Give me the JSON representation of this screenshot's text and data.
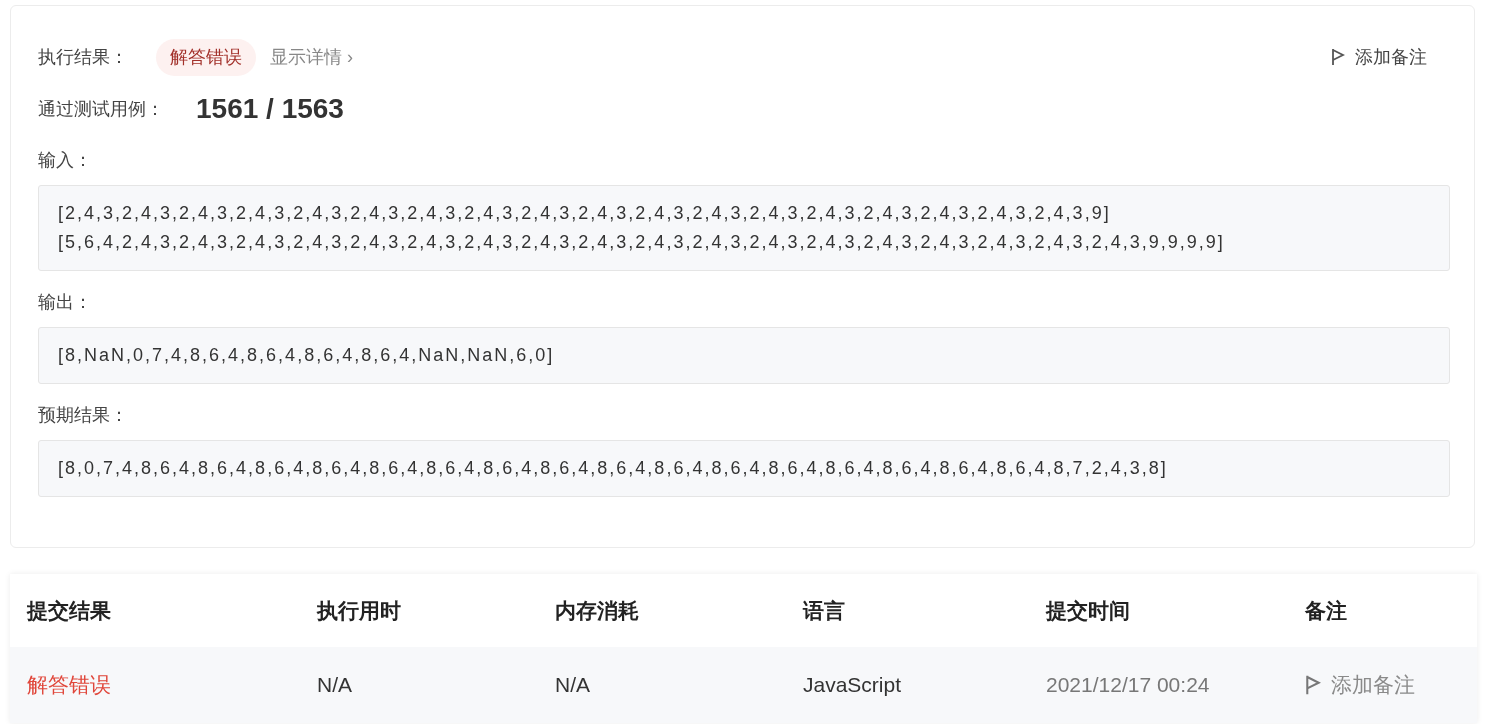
{
  "result": {
    "label": "执行结果：",
    "status": "解答错误",
    "details_link": "显示详情 ›",
    "note_button": "添加备注"
  },
  "passed": {
    "label": "通过测试用例：",
    "value": "1561 / 1563"
  },
  "blocks": [
    {
      "label": "输入：",
      "lines": [
        "[2,4,3,2,4,3,2,4,3,2,4,3,2,4,3,2,4,3,2,4,3,2,4,3,2,4,3,2,4,3,2,4,3,2,4,3,2,4,3,2,4,3,2,4,3,2,4,3,2,4,3,2,4,3,9]",
        "[5,6,4,2,4,3,2,4,3,2,4,3,2,4,3,2,4,3,2,4,3,2,4,3,2,4,3,2,4,3,2,4,3,2,4,3,2,4,3,2,4,3,2,4,3,2,4,3,2,4,3,2,4,3,2,4,3,9,9,9,9]"
      ]
    },
    {
      "label": "输出：",
      "lines": [
        "[8,NaN,0,7,4,8,6,4,8,6,4,8,6,4,8,6,4,NaN,NaN,6,0]"
      ]
    },
    {
      "label": "预期结果：",
      "lines": [
        "[8,0,7,4,8,6,4,8,6,4,8,6,4,8,6,4,8,6,4,8,6,4,8,6,4,8,6,4,8,6,4,8,6,4,8,6,4,8,6,4,8,6,4,8,6,4,8,6,4,8,6,4,8,7,2,4,3,8]"
      ]
    }
  ],
  "table": {
    "columns": [
      "提交结果",
      "执行用时",
      "内存消耗",
      "语言",
      "提交时间",
      "备注"
    ],
    "rows": [
      {
        "result": "解答错误",
        "runtime": "N/A",
        "memory": "N/A",
        "language": "JavaScript",
        "time": "2021/12/17 00:24",
        "note": "添加备注"
      }
    ]
  }
}
